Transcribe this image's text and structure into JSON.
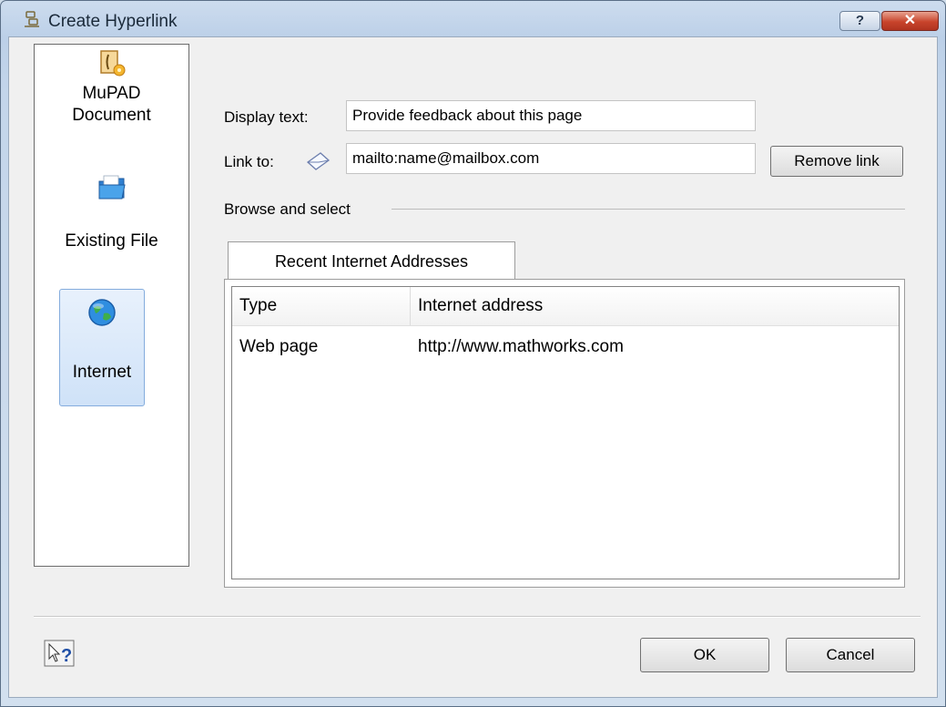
{
  "window": {
    "title": "Create Hyperlink",
    "help_glyph": "?",
    "close_glyph": "✕"
  },
  "sidebar": {
    "items": [
      {
        "label": "MuPAD Document",
        "icon": "mupad-document-icon"
      },
      {
        "label": "Existing File",
        "icon": "folder-icon"
      },
      {
        "label": "Internet",
        "icon": "globe-icon",
        "selected": true
      }
    ]
  },
  "form": {
    "display_text_label": "Display text:",
    "display_text_value": "Provide feedback about this page",
    "link_to_label": "Link to:",
    "link_to_value": "mailto:name@mailbox.com",
    "remove_link_label": "Remove link",
    "browse_group_label": "Browse and select"
  },
  "tabs": [
    {
      "label": "Recent Internet Addresses"
    }
  ],
  "table": {
    "headers": [
      "Type",
      "Internet address"
    ],
    "rows": [
      [
        "Web page",
        "http://www.mathworks.com"
      ]
    ]
  },
  "footer": {
    "ok_label": "OK",
    "cancel_label": "Cancel"
  }
}
